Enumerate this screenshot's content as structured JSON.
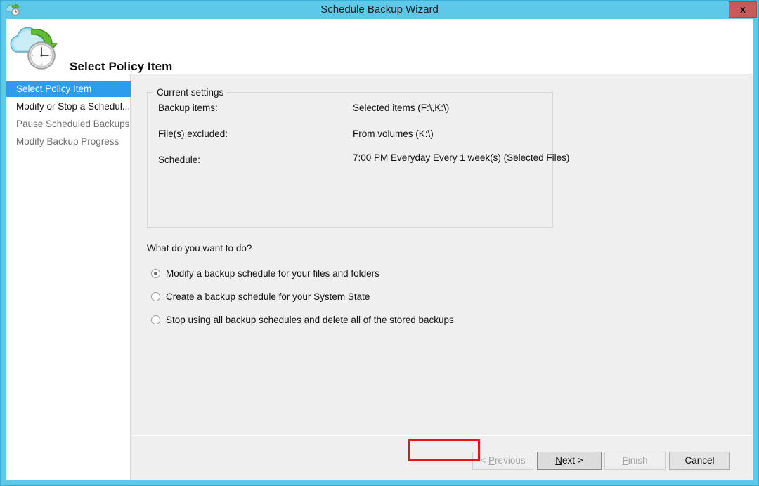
{
  "window": {
    "title": "Schedule Backup Wizard",
    "title_icon": "cloud-clock-icon",
    "close_label": "x",
    "frame_color": "#5ec8e8",
    "content_bg": "#efefef"
  },
  "header": {
    "page_title": "Select Policy Item",
    "icon": "cloud-backup-clock-icon"
  },
  "sidebar": {
    "items": [
      {
        "label": "Select Policy Item",
        "state": "selected"
      },
      {
        "label": "Modify or Stop a Schedul...",
        "state": "normal"
      },
      {
        "label": "Pause Scheduled Backups",
        "state": "dim"
      },
      {
        "label": "Modify Backup Progress",
        "state": "dim"
      }
    ],
    "selected_color": "#2d9ced"
  },
  "settings": {
    "legend": "Current settings",
    "rows": [
      {
        "label": "Backup items:",
        "value": "Selected items (F:\\,K:\\)"
      },
      {
        "label": "File(s) excluded:",
        "value": "From volumes (K:\\)"
      },
      {
        "label": "Schedule:",
        "value": "7:00 PM Everyday Every 1 week(s) (Selected Files)"
      }
    ]
  },
  "question": {
    "prompt": "What do you want to do?",
    "options": [
      {
        "label": "Modify a backup schedule for your files and folders",
        "checked": true
      },
      {
        "label": "Create a backup schedule for your System State",
        "checked": false
      },
      {
        "label": "Stop using all backup schedules and delete all of the stored backups",
        "checked": false
      }
    ]
  },
  "footer": {
    "buttons": [
      {
        "name": "previous",
        "label": "< Previous",
        "accel": "P",
        "disabled": true,
        "focused": false,
        "highlighted": false
      },
      {
        "name": "next",
        "label": "Next >",
        "accel": "N",
        "disabled": false,
        "focused": true,
        "highlighted": true
      },
      {
        "name": "finish",
        "label": "Finish",
        "accel": "F",
        "disabled": true,
        "focused": false,
        "highlighted": false
      },
      {
        "name": "cancel",
        "label": "Cancel",
        "accel": "",
        "disabled": false,
        "focused": false,
        "highlighted": false
      }
    ],
    "highlight_color": "#ee1111"
  }
}
